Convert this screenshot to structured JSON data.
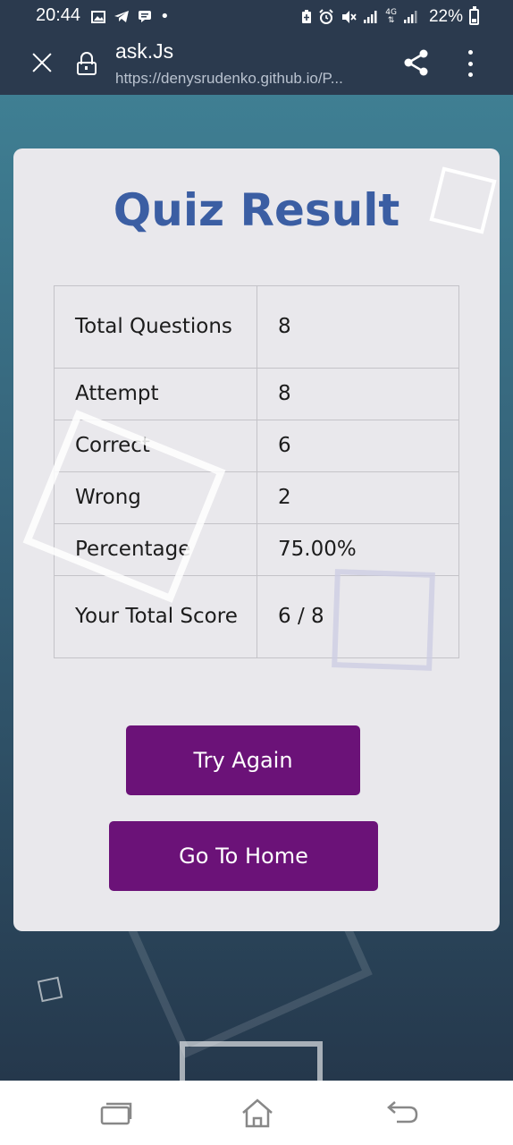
{
  "status_bar": {
    "time": "20:44",
    "battery": "22%",
    "left_icons": [
      "gallery-icon",
      "telegram-icon",
      "message-icon",
      "dot-icon"
    ],
    "right_icons": [
      "battery-saver-icon",
      "alarm-icon",
      "mute-icon",
      "signal-icon",
      "4g-icon",
      "signal-icon"
    ]
  },
  "browser": {
    "title": "ask.Js",
    "url": "https://denysrudenko.github.io/P..."
  },
  "card": {
    "title": "Quiz Result",
    "rows": [
      {
        "label": "Total Questions",
        "value": "8"
      },
      {
        "label": "Attempt",
        "value": "8"
      },
      {
        "label": "Correct",
        "value": "6"
      },
      {
        "label": "Wrong",
        "value": "2"
      },
      {
        "label": "Percentage",
        "value": "75.00%"
      },
      {
        "label": "Your Total Score",
        "value": "6 / 8"
      }
    ],
    "try_again_label": "Try Again",
    "go_home_label": "Go To Home"
  },
  "colors": {
    "title": "#3b5ea3",
    "button": "#6b1278",
    "card": "#e9e8ec",
    "chrome": "#2b3a4e"
  }
}
